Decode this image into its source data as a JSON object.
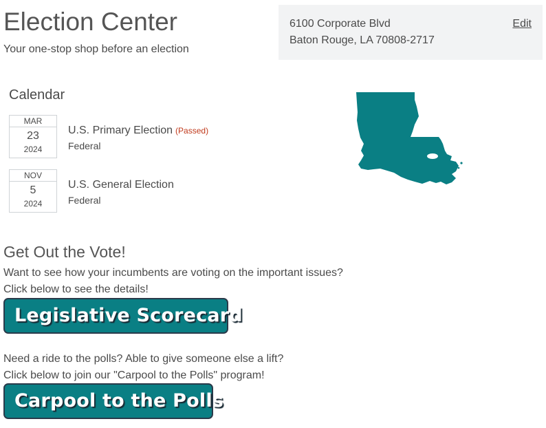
{
  "header": {
    "title": "Election Center",
    "subtitle": "Your one-stop shop before an election"
  },
  "address": {
    "line1": "6100 Corporate Blvd",
    "line2": "Baton Rouge, LA 70808-2717",
    "edit_label": "Edit"
  },
  "calendar": {
    "heading": "Calendar",
    "events": [
      {
        "month": "MAR",
        "day": "23",
        "year": "2024",
        "title": "U.S. Primary Election",
        "status": "(Passed)",
        "type": "Federal"
      },
      {
        "month": "NOV",
        "day": "5",
        "year": "2024",
        "title": "U.S. General Election",
        "status": "",
        "type": "Federal"
      }
    ]
  },
  "map": {
    "icon": "louisiana-state-icon",
    "color": "#0a7f84"
  },
  "gotv": {
    "heading": "Get Out the Vote!",
    "scorecard_text_1": "Want to see how your incumbents are voting on the important issues?",
    "scorecard_text_2": "Click below to see the details!",
    "scorecard_button": "Legislative Scorecard",
    "carpool_text_1": "Need a ride to the polls? Able to give someone else a lift?",
    "carpool_text_2": "Click below to join our \"Carpool to the Polls\" program!",
    "carpool_button": "Carpool to the Polls"
  },
  "colors": {
    "accent": "#0a7f84",
    "passed": "#c0391b",
    "address_bg": "#f2f3f4"
  }
}
